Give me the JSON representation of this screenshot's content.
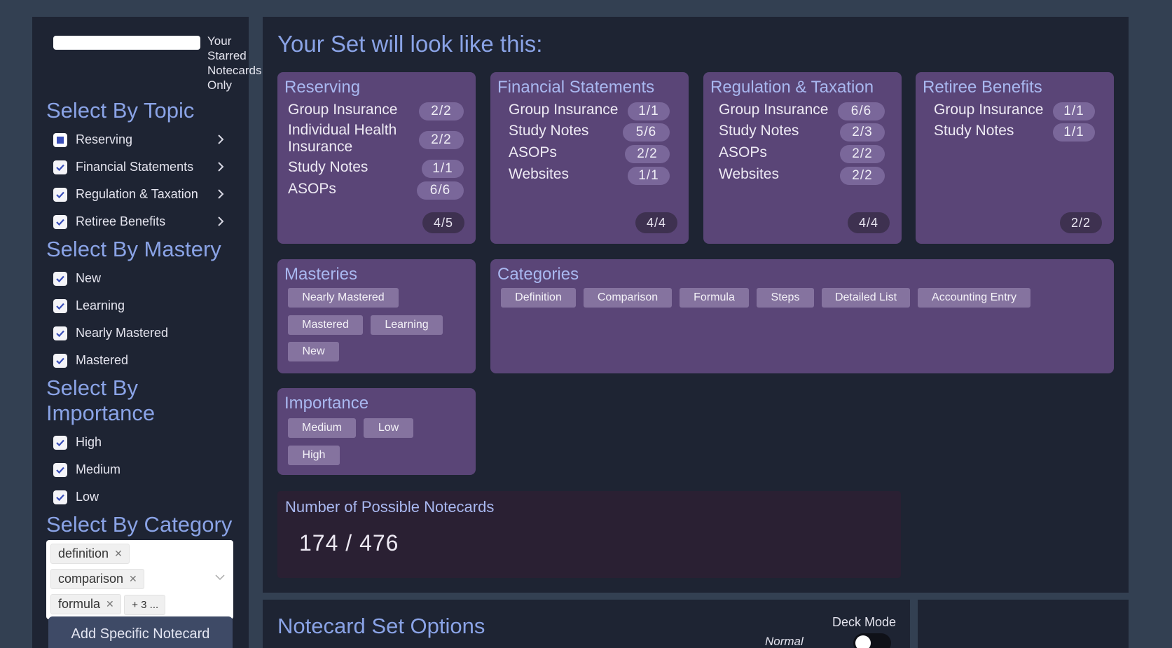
{
  "sidebar": {
    "starred_label": "Your Starred Notecards Only",
    "topic_title": "Select By Topic",
    "topics": [
      {
        "label": "Reserving",
        "state": "partial"
      },
      {
        "label": "Financial Statements",
        "state": "checked"
      },
      {
        "label": "Regulation & Taxation",
        "state": "checked"
      },
      {
        "label": "Retiree Benefits",
        "state": "checked"
      }
    ],
    "mastery_title": "Select By Mastery",
    "mastery": [
      "New",
      "Learning",
      "Nearly Mastered",
      "Mastered"
    ],
    "importance_title": "Select By Importance",
    "importance": [
      "High",
      "Medium",
      "Low"
    ],
    "category_title": "Select By Category",
    "category_tags": [
      "definition",
      "comparison",
      "formula"
    ],
    "category_more": "+ 3 ...",
    "add_button": "Add Specific Notecard"
  },
  "main": {
    "title": "Your Set will look like this:",
    "topic_cards": [
      {
        "title": "Reserving",
        "rows": [
          {
            "label": "Group Insurance",
            "count": "2/2"
          },
          {
            "label": "Individual Health Insurance",
            "count": "2/2"
          },
          {
            "label": "Study Notes",
            "count": "1/1"
          },
          {
            "label": "ASOPs",
            "count": "6/6"
          }
        ],
        "total": "4/5"
      },
      {
        "title": "Financial Statements",
        "rows": [
          {
            "label": "Group Insurance",
            "count": "1/1"
          },
          {
            "label": "Study Notes",
            "count": "5/6"
          },
          {
            "label": "ASOPs",
            "count": "2/2"
          },
          {
            "label": "Websites",
            "count": "1/1"
          }
        ],
        "total": "4/4"
      },
      {
        "title": "Regulation & Taxation",
        "rows": [
          {
            "label": "Group Insurance",
            "count": "6/6"
          },
          {
            "label": "Study Notes",
            "count": "2/3"
          },
          {
            "label": "ASOPs",
            "count": "2/2"
          },
          {
            "label": "Websites",
            "count": "2/2"
          }
        ],
        "total": "4/4"
      },
      {
        "title": "Retiree Benefits",
        "rows": [
          {
            "label": "Group Insurance",
            "count": "1/1"
          },
          {
            "label": "Study Notes",
            "count": "1/1"
          }
        ],
        "total": "2/2"
      }
    ],
    "masteries_title": "Masteries",
    "masteries": [
      "Nearly Mastered",
      "Mastered",
      "Learning",
      "New"
    ],
    "categories_title": "Categories",
    "categories": [
      "Definition",
      "Comparison",
      "Formula",
      "Steps",
      "Detailed List",
      "Accounting Entry"
    ],
    "importance_title": "Importance",
    "importance": [
      "Medium",
      "Low",
      "High"
    ],
    "count_title": "Number of Possible Notecards",
    "count_value": "174 / 476"
  },
  "options": {
    "title": "Notecard Set Options",
    "deck_mode_label": "Deck Mode",
    "mode_value": "Normal"
  },
  "colors": {
    "background": "#334052",
    "panel": "#1e2433",
    "card": "#5a4577",
    "accent": "#8aa3e6"
  }
}
